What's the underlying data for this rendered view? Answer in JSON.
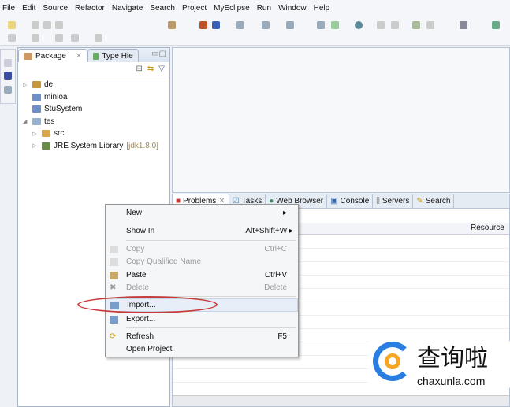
{
  "menu": [
    "File",
    "Edit",
    "Source",
    "Refactor",
    "Navigate",
    "Search",
    "Project",
    "MyEclipse",
    "Run",
    "Window",
    "Help"
  ],
  "package_explorer": {
    "tabs": [
      {
        "label": "Package"
      },
      {
        "label": "Type Hie"
      }
    ],
    "tree": [
      {
        "label": "de",
        "decor": ""
      },
      {
        "label": "minioa",
        "decor": ""
      },
      {
        "label": "StuSystem",
        "decor": ""
      },
      {
        "label": "tes",
        "decor": ""
      },
      {
        "label": "src",
        "decor": ""
      },
      {
        "label": "JRE System Library",
        "decor": "[jdk1.8.0]"
      }
    ]
  },
  "bottom_panel": {
    "tabs": [
      "Problems",
      "Tasks",
      "Web Browser",
      "Console",
      "Servers",
      "Search"
    ],
    "column_resource": "Resource"
  },
  "context_menu": {
    "items": [
      {
        "label": "New",
        "shortcut": "▸"
      },
      {
        "label": "Show In",
        "shortcut": "Alt+Shift+W ▸"
      },
      {
        "label": "Copy",
        "shortcut": "Ctrl+C"
      },
      {
        "label": "Copy Qualified Name",
        "shortcut": ""
      },
      {
        "label": "Paste",
        "shortcut": "Ctrl+V"
      },
      {
        "label": "Delete",
        "shortcut": "Delete"
      },
      {
        "label": "Import...",
        "shortcut": ""
      },
      {
        "label": "Export...",
        "shortcut": ""
      },
      {
        "label": "Refresh",
        "shortcut": "F5"
      },
      {
        "label": "Open Project",
        "shortcut": ""
      }
    ]
  },
  "watermark": {
    "title": "查询啦",
    "url": "chaxunla.com"
  }
}
